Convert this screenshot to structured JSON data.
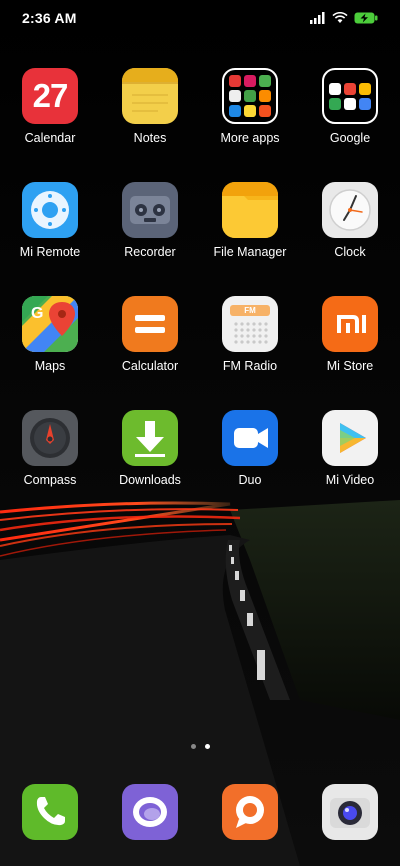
{
  "status_bar": {
    "time": "2:36 AM",
    "icons": [
      "signal-icon",
      "wifi-icon",
      "battery-charging-icon"
    ]
  },
  "apps": {
    "calendar": {
      "label": "Calendar",
      "date": "27",
      "icon": "calendar-icon",
      "color": "#e8323a"
    },
    "notes": {
      "label": "Notes",
      "icon": "notes-icon",
      "color": "#f3cf4a"
    },
    "more_apps": {
      "label": "More apps",
      "icon": "folder-icon"
    },
    "google": {
      "label": "Google",
      "icon": "folder-icon"
    },
    "mi_remote": {
      "label": "Mi Remote",
      "icon": "remote-icon",
      "color": "#2ea1f2"
    },
    "recorder": {
      "label": "Recorder",
      "icon": "recorder-icon",
      "color": "#5b6478"
    },
    "file_manager": {
      "label": "File Manager",
      "icon": "folder-file-icon",
      "color": "#f7b51a"
    },
    "clock": {
      "label": "Clock",
      "icon": "clock-icon",
      "color": "#e9e9e9"
    },
    "maps": {
      "label": "Maps",
      "icon": "maps-icon"
    },
    "calculator": {
      "label": "Calculator",
      "icon": "calculator-icon",
      "color": "#f07a1e"
    },
    "fm_radio": {
      "label": "FM Radio",
      "badge": "FM",
      "icon": "radio-icon",
      "color": "#f1f1f1"
    },
    "mi_store": {
      "label": "Mi Store",
      "badge": "mi",
      "icon": "mi-store-icon",
      "color": "#f56b16"
    },
    "compass": {
      "label": "Compass",
      "icon": "compass-icon",
      "color": "#55585d"
    },
    "downloads": {
      "label": "Downloads",
      "icon": "download-arrow-icon",
      "color": "#6dbb2d"
    },
    "duo": {
      "label": "Duo",
      "icon": "video-camera-icon",
      "color": "#1a73e8"
    },
    "mi_video": {
      "label": "Mi Video",
      "icon": "play-icon",
      "color": "#f2f2f2"
    }
  },
  "dock": {
    "phone": {
      "icon": "phone-icon",
      "color": "#5fba2a"
    },
    "messaging": {
      "icon": "messaging-icon",
      "color": "#7e62d6"
    },
    "browser": {
      "icon": "browser-icon",
      "color": "#f26f2a"
    },
    "camera": {
      "icon": "camera-icon",
      "color": "#e8e8e8"
    }
  },
  "page_indicator": {
    "count": 2,
    "active": 2
  }
}
